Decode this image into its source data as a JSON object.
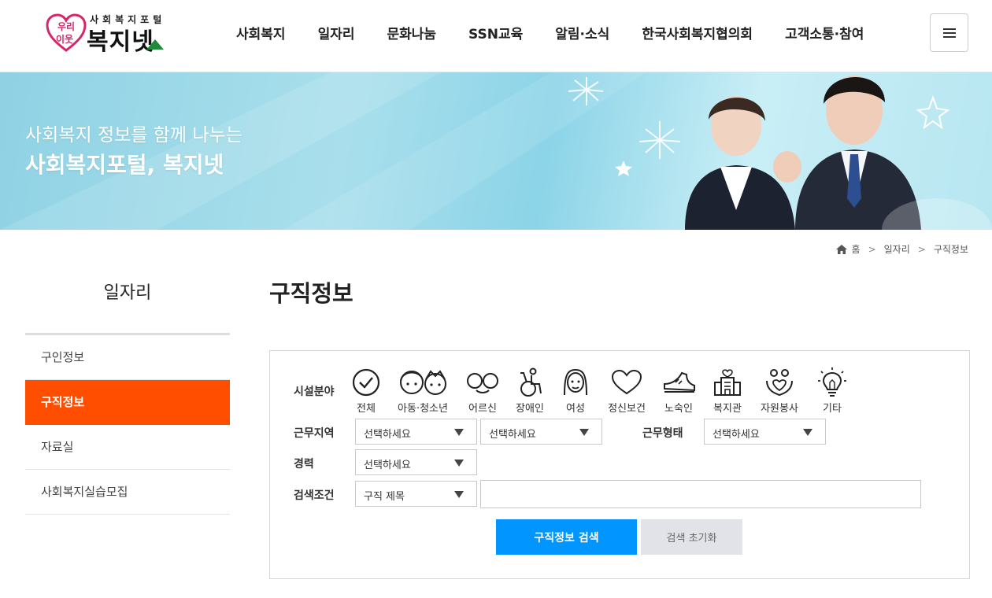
{
  "header": {
    "logo_heart_text": "우리 이웃",
    "logo_sub": "사회복지포털",
    "logo_main": "복지넷",
    "nav": [
      "사회복지",
      "일자리",
      "문화나눔",
      "SSN교육",
      "알림·소식",
      "한국사회복지협의회",
      "고객소통·참여"
    ],
    "menu_icon": "hamburger-icon"
  },
  "banner": {
    "line1": "사회복지 정보를 함께 나누는",
    "line2": "사회복지포털, 복지넷"
  },
  "breadcrumb": {
    "home_icon": "home-icon",
    "items": [
      "홈",
      "일자리",
      "구직정보"
    ]
  },
  "sidebar": {
    "title": "일자리",
    "items": [
      "구인정보",
      "구직정보",
      "자료실",
      "사회복지실습모집"
    ],
    "active_index": 1
  },
  "main": {
    "title": "구직정보",
    "facility_label": "시설분야",
    "categories": [
      {
        "label": "전체",
        "icon": "check-circle-icon"
      },
      {
        "label": "아동·청소년",
        "icon": "children-icon"
      },
      {
        "label": "어르신",
        "icon": "glasses-icon"
      },
      {
        "label": "장애인",
        "icon": "wheelchair-icon"
      },
      {
        "label": "여성",
        "icon": "woman-icon"
      },
      {
        "label": "정신보건",
        "icon": "heart-icon"
      },
      {
        "label": "노숙인",
        "icon": "shoe-icon"
      },
      {
        "label": "복지관",
        "icon": "building-icon"
      },
      {
        "label": "자원봉사",
        "icon": "helping-hands-icon"
      },
      {
        "label": "기타",
        "icon": "lightbulb-icon"
      }
    ],
    "region_label": "근무지역",
    "region_select_1": "선택하세요",
    "region_select_2": "선택하세요",
    "worktype_label": "근무형태",
    "worktype_select": "선택하세요",
    "career_label": "경력",
    "career_select": "선택하세요",
    "condition_label": "검색조건",
    "condition_select": "구직 제목",
    "keyword_value": "",
    "search_button": "구직정보 검색",
    "reset_button": "검색 초기화"
  },
  "colors": {
    "accent": "#ff4e00",
    "primary_button": "#0095ff",
    "logo_pink": "#d6256b",
    "logo_green": "#1f8a3a"
  }
}
